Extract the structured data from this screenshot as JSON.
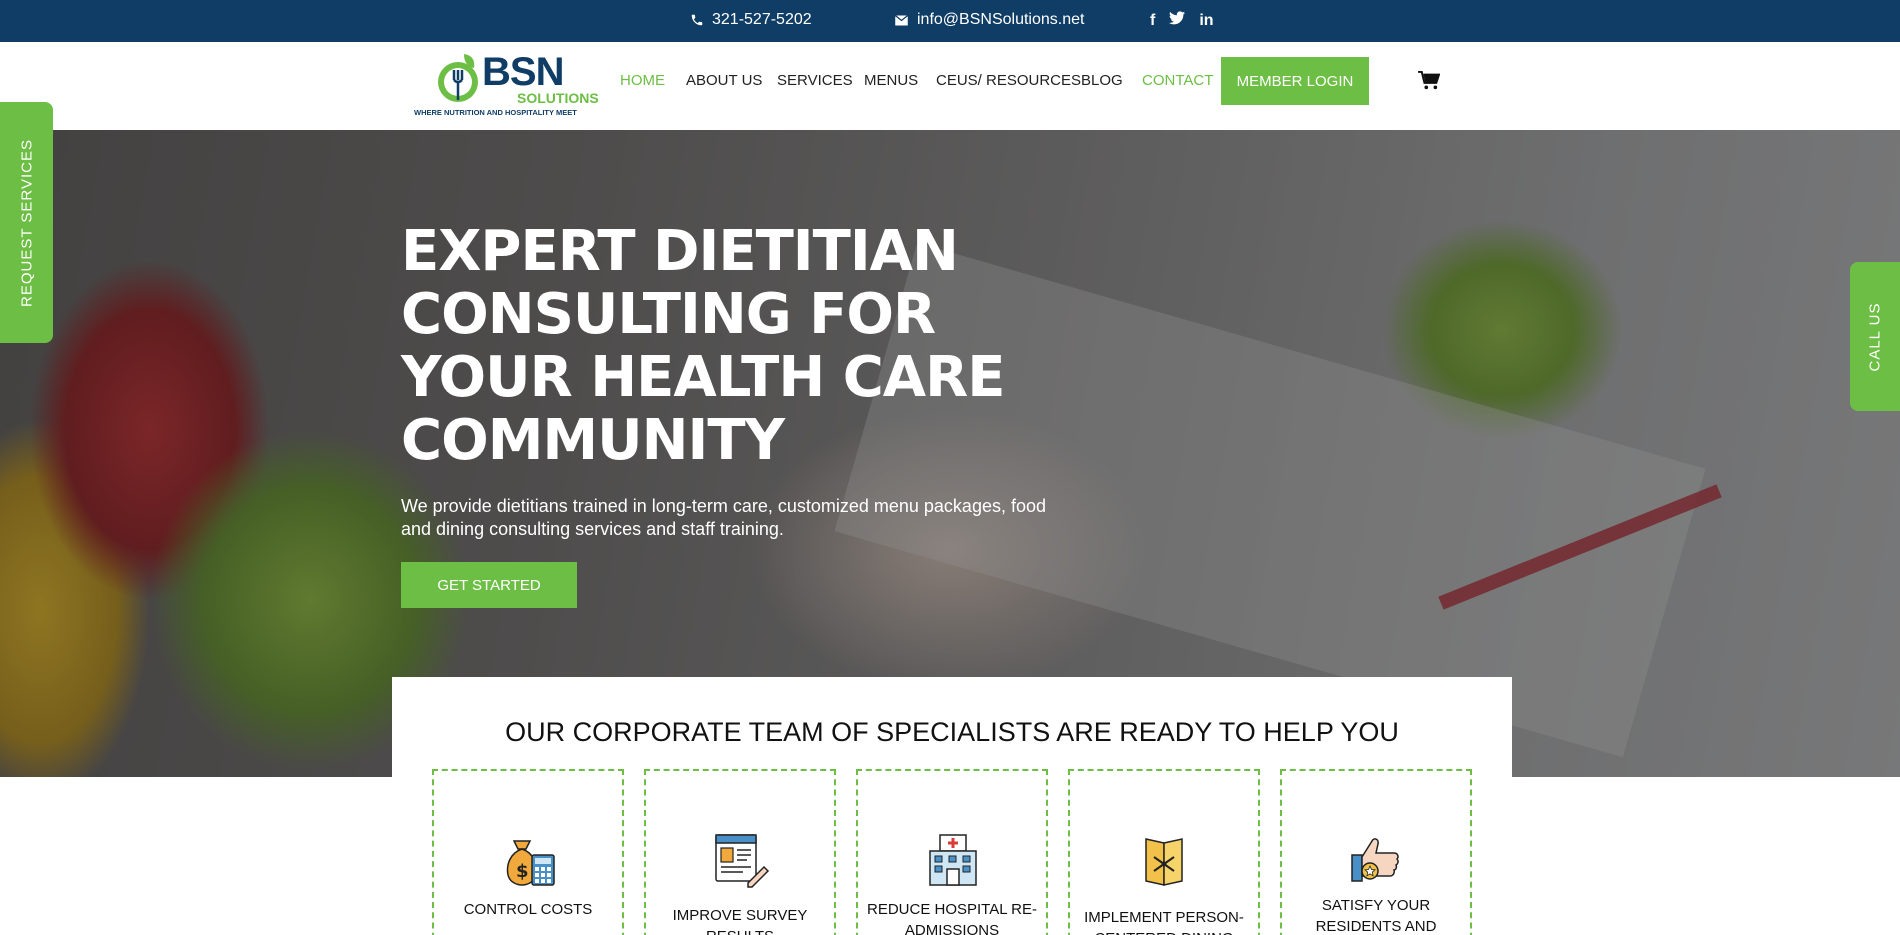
{
  "topbar": {
    "phone": "321-527-5202",
    "email": "info@BSNSolutions.net",
    "social": [
      "f",
      "t",
      "in"
    ]
  },
  "logo": {
    "brand": "BSN",
    "sub": "SOLUTIONS",
    "tagline": "WHERE NUTRITION AND HOSPITALITY MEET"
  },
  "nav": {
    "items": [
      {
        "label": "HOME"
      },
      {
        "label": "ABOUT US"
      },
      {
        "label": "SERVICES"
      },
      {
        "label": "MENUS"
      },
      {
        "label": "CEUS/ RESOURCES"
      },
      {
        "label": "BLOG"
      },
      {
        "label": "CONTACT"
      }
    ],
    "login": "MEMBER LOGIN"
  },
  "hero": {
    "title": "EXPERT DIETITIAN CONSULTING FOR YOUR HEALTH CARE COMMUNITY",
    "subtitle": "We provide dietitians trained in long-term care, customized menu packages, food and dining consulting services and staff training.",
    "cta": "GET STARTED"
  },
  "side_tabs": {
    "left": "REQUEST SERVICES",
    "right": "CALL US"
  },
  "specialists": {
    "heading": "OUR CORPORATE TEAM OF SPECIALISTS ARE READY TO HELP YOU",
    "cards": [
      {
        "label": "CONTROL COSTS",
        "icon": "money-bag-calculator-icon"
      },
      {
        "label": "IMPROVE SURVEY RESULTS",
        "icon": "survey-document-icon"
      },
      {
        "label": "REDUCE HOSPITAL RE-ADMISSIONS",
        "icon": "hospital-icon"
      },
      {
        "label": "IMPLEMENT PERSON-CENTERED DINING",
        "icon": "menu-card-icon"
      },
      {
        "label": "SATISFY YOUR RESIDENTS AND",
        "icon": "thumbs-up-star-icon"
      }
    ]
  },
  "colors": {
    "navy": "#0f3d66",
    "green": "#6cbf44"
  }
}
